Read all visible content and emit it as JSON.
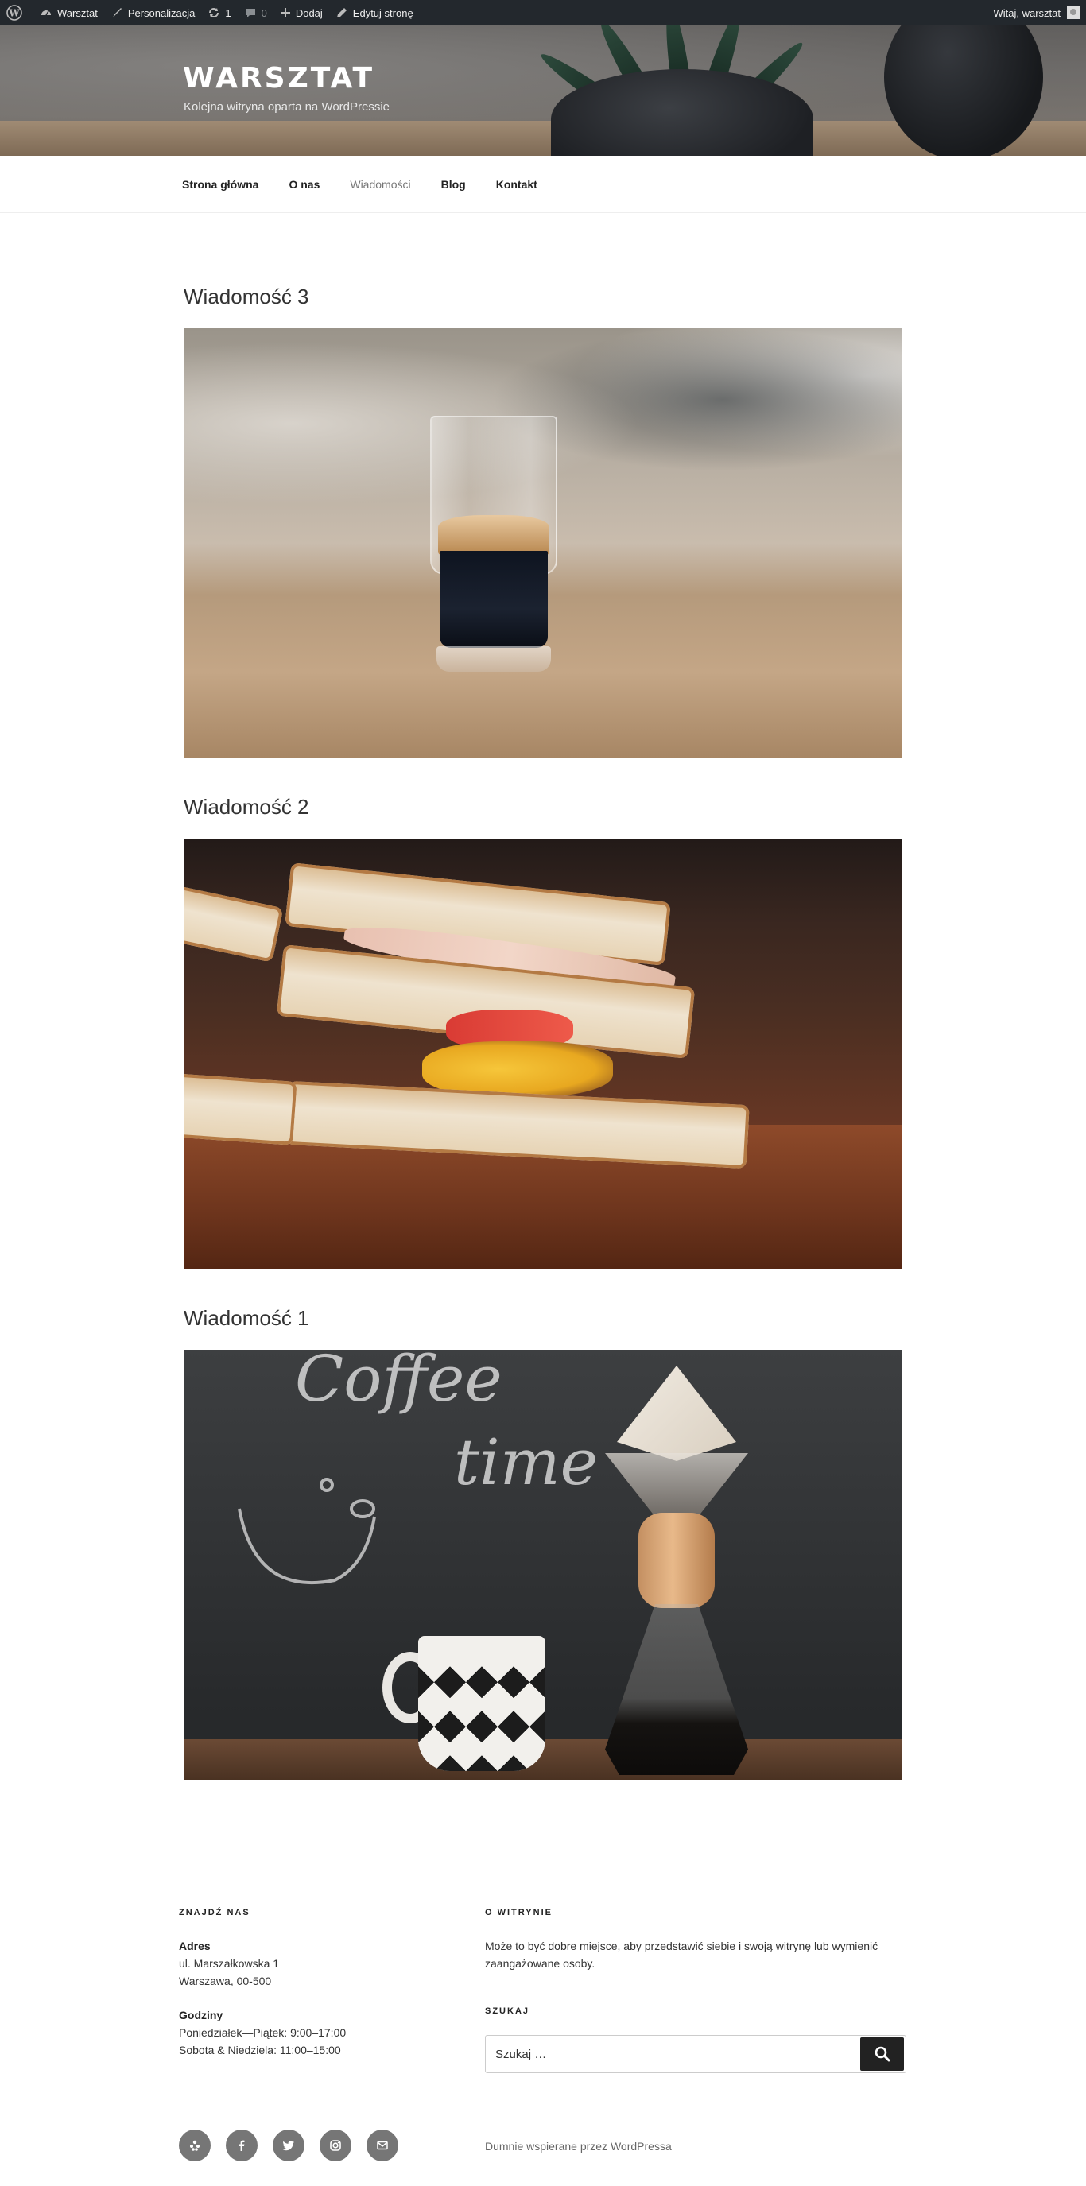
{
  "admin_bar": {
    "site_name": "Warsztat",
    "customize": "Personalizacja",
    "updates_count": "1",
    "comments_count": "0",
    "new_label": "Dodaj",
    "edit_page": "Edytuj stronę",
    "greeting": "Witaj, warsztat"
  },
  "header": {
    "site_title": "WARSZTAT",
    "tagline": "Kolejna witryna oparta na WordPressie"
  },
  "nav": {
    "items": [
      {
        "label": "Strona główna"
      },
      {
        "label": "O nas"
      },
      {
        "label": "Wiadomości",
        "active": true
      },
      {
        "label": "Blog"
      },
      {
        "label": "Kontakt"
      }
    ]
  },
  "posts": [
    {
      "title": "Wiadomość 3"
    },
    {
      "title": "Wiadomość 2"
    },
    {
      "title": "Wiadomość 1"
    }
  ],
  "images": {
    "coffee_time_text_1": "Coffee",
    "coffee_time_text_2": "time"
  },
  "footer": {
    "find_us": {
      "title": "ZNAJDŹ NAS",
      "address_label": "Adres",
      "address_line1": "ul. Marszałkowska 1",
      "address_line2": "Warszawa, 00-500",
      "hours_label": "Godziny",
      "hours_line1": "Poniedziałek—Piątek: 9:00–17:00",
      "hours_line2": "Sobota & Niedziela: 11:00–15:00"
    },
    "about": {
      "title": "O WITRYNIE",
      "text_line1": "Może to być dobre miejsce, aby przedstawić siebie i swoją witrynę lub wymienić",
      "text_line2": "zaangażowane osoby."
    },
    "search": {
      "title": "SZUKAJ",
      "placeholder": "Szukaj …"
    },
    "social_icons": [
      "yelp-icon",
      "facebook-icon",
      "twitter-icon",
      "instagram-icon",
      "email-icon"
    ],
    "powered_by": "Dumnie wspierane przez WordPressa"
  }
}
